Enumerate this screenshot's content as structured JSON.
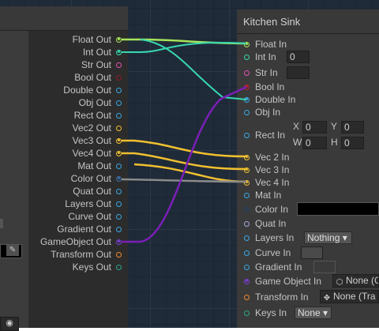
{
  "left_node": {
    "outputs": [
      {
        "label": "Float Out",
        "color": "#a6e45a",
        "filled": true
      },
      {
        "label": "Int Out",
        "color": "#36d8b0",
        "filled": true
      },
      {
        "label": "Str Out",
        "color": "#e64db8",
        "filled": false
      },
      {
        "label": "Bool Out",
        "color": "#8c1a2a",
        "filled": false
      },
      {
        "label": "Double Out",
        "color": "#38a8e6",
        "filled": false
      },
      {
        "label": "Obj Out",
        "color": "#38a8e6",
        "filled": false
      },
      {
        "label": "Rect Out",
        "color": "#38a8e6",
        "filled": false
      },
      {
        "label": "Vec2 Out",
        "color": "#f0c030",
        "filled": false
      },
      {
        "label": "Vec3 Out",
        "color": "#f0c030",
        "filled": true
      },
      {
        "label": "Vec4 Out",
        "color": "#f0c030",
        "filled": true
      },
      {
        "label": "Mat Out",
        "color": "#38a8e6",
        "filled": false
      },
      {
        "label": "Color Out",
        "color": "#3a6fa8",
        "filled": true
      },
      {
        "label": "Quat Out",
        "color": "#38a8e6",
        "filled": false
      },
      {
        "label": "Layers Out",
        "color": "#38a8e6",
        "filled": false
      },
      {
        "label": "Curve Out",
        "color": "#38a8e6",
        "filled": false
      },
      {
        "label": "Gradient Out",
        "color": "#38a8e6",
        "filled": false
      },
      {
        "label": "GameObject Out",
        "color": "#7a3fd6",
        "filled": true
      },
      {
        "label": "Transform Out",
        "color": "#f08a30",
        "filled": false
      },
      {
        "label": "Keys Out",
        "color": "#2aa88a",
        "filled": false
      }
    ]
  },
  "right_node": {
    "title": "Kitchen Sink",
    "inputs": {
      "float": {
        "label": "Float In",
        "color": "#a6e45a",
        "filled": true
      },
      "int": {
        "label": "Int In",
        "color": "#36d8b0",
        "filled": false,
        "value": "0"
      },
      "str": {
        "label": "Str In",
        "color": "#e64db8",
        "filled": false,
        "value": ""
      },
      "bool": {
        "label": "Bool In",
        "color": "#c02030",
        "filled": true
      },
      "double": {
        "label": "Double In",
        "color": "#38a8e6",
        "filled": true
      },
      "obj": {
        "label": "Obj In",
        "color": "#38a8e6",
        "filled": false
      },
      "rect": {
        "label": "Rect In",
        "color": "#38a8e6",
        "filled": false,
        "x_label": "X",
        "x": "0",
        "y_label": "Y",
        "y": "0",
        "w_label": "W",
        "w": "0",
        "h_label": "H",
        "h": "0"
      },
      "vec2": {
        "label": "Vec 2 In",
        "color": "#f0c030",
        "filled": true
      },
      "vec3": {
        "label": "Vec 3 In",
        "color": "#f0c030",
        "filled": true
      },
      "vec4": {
        "label": "Vec 4 In",
        "color": "#f0c030",
        "filled": true
      },
      "mat": {
        "label": "Mat In",
        "color": "#38a8e6",
        "filled": false
      },
      "color": {
        "label": "Color In",
        "color": "#2a3f5c",
        "filled": true,
        "swatch": "#000000"
      },
      "quat": {
        "label": "Quat In",
        "color": "#a0a8e0",
        "filled": false
      },
      "layers": {
        "label": "Layers In",
        "color": "#38a8e6",
        "filled": false,
        "value": "Nothing"
      },
      "curve": {
        "label": "Curve In",
        "color": "#38a8e6",
        "filled": false
      },
      "gradient": {
        "label": "Gradient In",
        "color": "#38a8e6",
        "filled": false
      },
      "gameobject": {
        "label": "Game Object In",
        "color": "#7a3fd6",
        "filled": true,
        "value": "None (G"
      },
      "transform": {
        "label": "Transform In",
        "color": "#f08a30",
        "filled": false,
        "value": "None (Tra"
      },
      "keys": {
        "label": "Keys In",
        "color": "#2aa88a",
        "filled": false,
        "value": "None"
      }
    }
  },
  "wire_colors": {
    "float": "#a6e45a",
    "int": "#36d8b0",
    "gameobject_bool": "#7a1fb8",
    "vec": "#f0c030",
    "color": "#8a8a8a"
  }
}
